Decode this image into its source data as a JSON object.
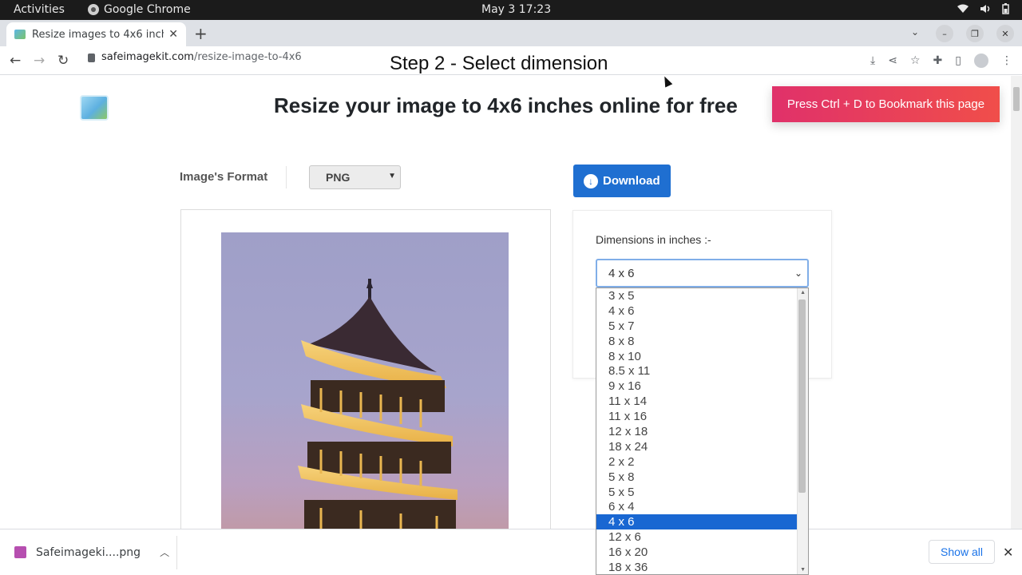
{
  "system_bar": {
    "activities": "Activities",
    "app_name": "Google Chrome",
    "clock": "May 3  17:23"
  },
  "browser": {
    "tab_title": "Resize images to 4x6 inch",
    "url_host": "safeimagekit.com",
    "url_path": "/resize-image-to-4x6"
  },
  "overlay_caption": "Step 2 - Select dimension",
  "page": {
    "heading": "Resize your image to 4x6 inches online for free",
    "bookmark_banner": "Press Ctrl + D to Bookmark this page",
    "format_label": "Image's Format",
    "format_value": "PNG",
    "download_label": "Download",
    "dimensions_label": "Dimensions in inches :-",
    "dimension_selected": "4 x 6",
    "dimension_options": [
      "3 x 5",
      "4 x 6",
      "5 x 7",
      "8 x 8",
      "8 x 10",
      "8.5 x 11",
      "9 x 16",
      "11 x 14",
      "11 x 16",
      "12 x 18",
      "18 x 24",
      "2 x 2",
      "5 x 8",
      "5 x 5",
      "6 x 4",
      "4 x 6",
      "12 x 6",
      "16 x 20",
      "18 x 36"
    ],
    "highlighted_option_index": 15
  },
  "download_shelf": {
    "file_name": "Safeimageki....png",
    "show_all": "Show all"
  }
}
